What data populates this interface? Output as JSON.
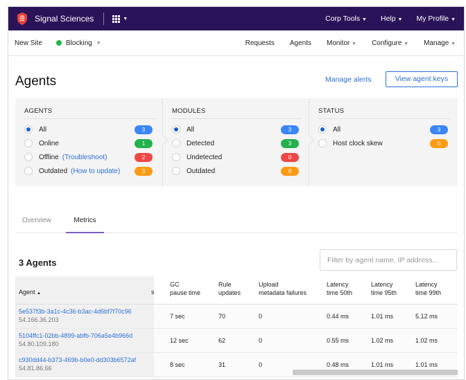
{
  "topbar": {
    "brand": "Signal Sciences",
    "items": [
      "Corp Tools",
      "Help",
      "My Profile"
    ]
  },
  "subnav": {
    "site": "New Site",
    "mode": "Blocking",
    "items": [
      "Requests",
      "Agents",
      "Monitor",
      "Configure",
      "Manage"
    ]
  },
  "page": {
    "title": "Agents",
    "manage_alerts": "Manage alerts",
    "view_keys": "View agent keys"
  },
  "filters": {
    "agents": {
      "heading": "AGENTS",
      "options": [
        {
          "label": "All",
          "count": "3"
        },
        {
          "label": "Online",
          "count": "1"
        },
        {
          "label": "Offline",
          "link": "(Troubleshoot)",
          "count": "2"
        },
        {
          "label": "Outdated",
          "link": "(How to update)",
          "count": "3"
        }
      ]
    },
    "modules": {
      "heading": "MODULES",
      "options": [
        {
          "label": "All",
          "count": "3"
        },
        {
          "label": "Detected",
          "count": "3"
        },
        {
          "label": "Undetected",
          "count": "0"
        },
        {
          "label": "Outdated",
          "count": "0"
        }
      ]
    },
    "status": {
      "heading": "STATUS",
      "options": [
        {
          "label": "All",
          "count": "3"
        },
        {
          "label": "Host clock skew",
          "count": "0"
        }
      ]
    }
  },
  "colors": {
    "brand_bar": "#2b1359",
    "link": "#2b6fd6",
    "blue": "#3b86f6",
    "green": "#22b14c",
    "red": "#ef4747",
    "orange": "#fb9b14",
    "tab_underline": "#7a5ec2"
  },
  "icons": {
    "logo": "signal-sciences-logo",
    "apps": "grid-icon",
    "dropdown": "caret-down-icon",
    "status": "green-dot-icon"
  },
  "tabs": [
    "Overview",
    "Metrics"
  ],
  "active_tab": "Metrics",
  "agents_count": "3 Agents",
  "search_placeholder": "Filter by agent name, IP address...",
  "table": {
    "agent_header": "Agent",
    "sort_indicator": "▲",
    "clipped_header": "s",
    "headers": [
      [
        "GC",
        "pause time"
      ],
      [
        "Rule",
        "updates"
      ],
      [
        "Upload",
        "metadata failures"
      ],
      [
        "Latency",
        "time 50th"
      ],
      [
        "Latency",
        "time 95th"
      ],
      [
        "Latency",
        "time 99th"
      ]
    ],
    "rows": [
      {
        "id": "5e537f3b-3a1c-4c36-b3ac-4d6bf7f70c96",
        "ip": "54.166.36.203",
        "gc": "7 sec",
        "rule": "70",
        "upload": "0",
        "l50": "0.44 ms",
        "l95": "1.01 ms",
        "l99": "5.12 ms"
      },
      {
        "id": "5104ffc1-02bb-4899-abfb-706a5e4b966d",
        "ip": "54.80.109.180",
        "gc": "12 sec",
        "rule": "62",
        "upload": "0",
        "l50": "0.55 ms",
        "l95": "1.02 ms",
        "l99": "1.02 ms"
      },
      {
        "id": "c930dd44-b373-469b-b0e0-dd303b6572af",
        "ip": "54.81.86.66",
        "gc": "8 sec",
        "rule": "31",
        "upload": "0",
        "l50": "0.48 ms",
        "l95": "1.01 ms",
        "l99": "1.01 ms"
      }
    ]
  }
}
